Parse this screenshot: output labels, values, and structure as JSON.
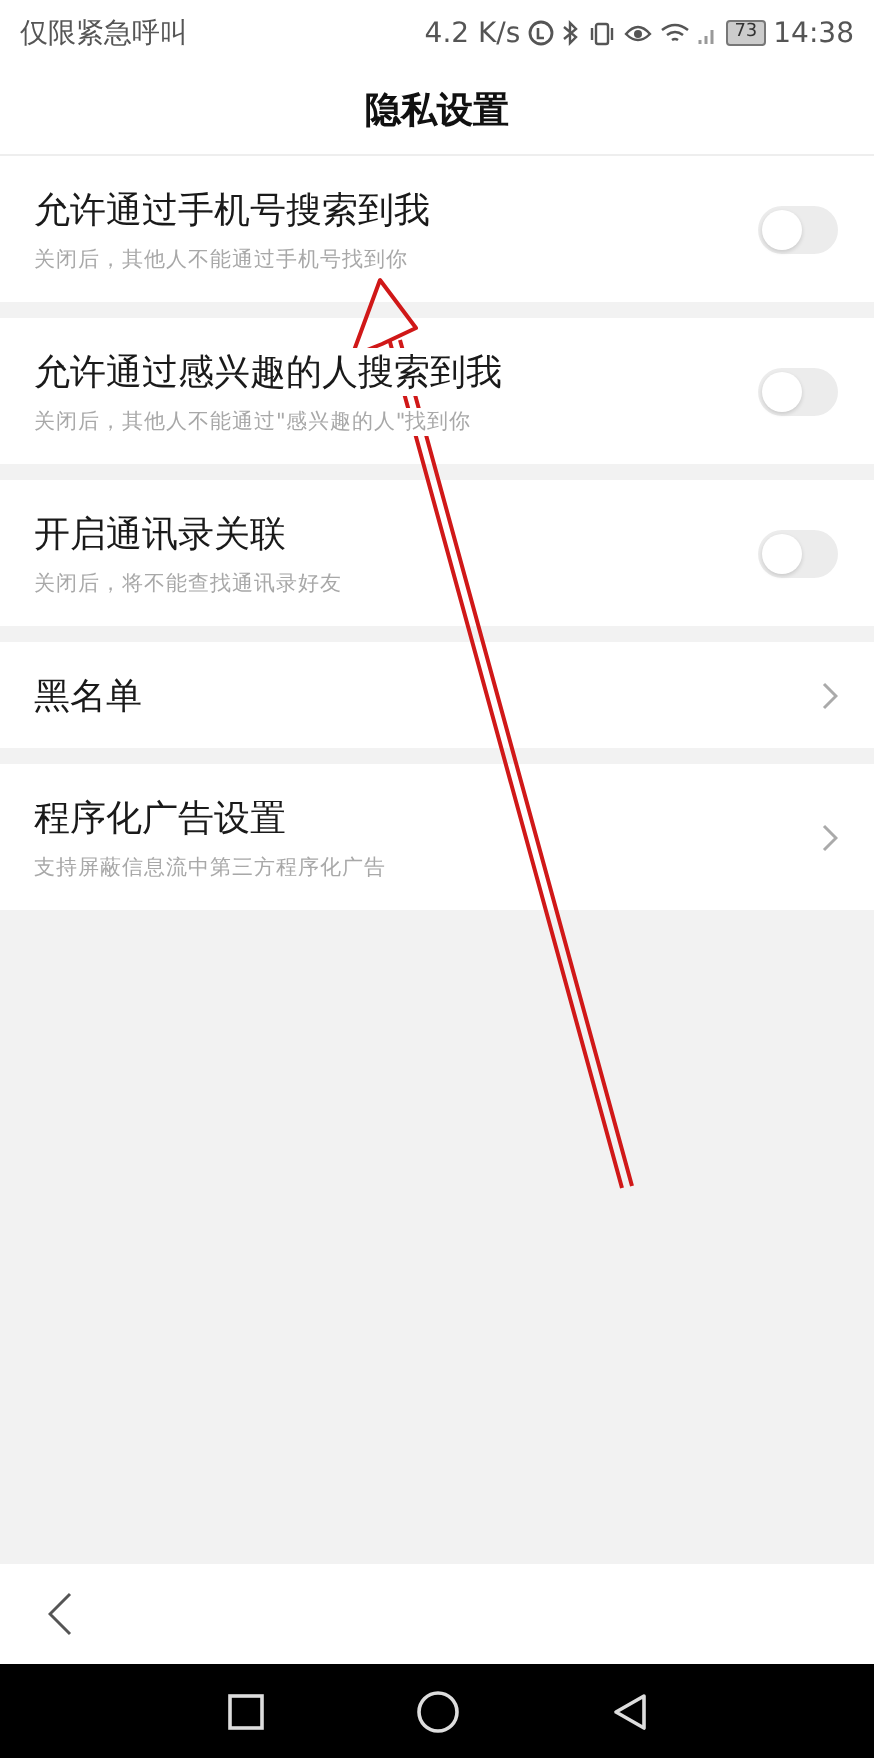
{
  "status_bar": {
    "carrier": "仅限紧急呼叫",
    "speed": "4.2 K/s",
    "battery": "73",
    "time": "14:38"
  },
  "title": "隐私设置",
  "sections": [
    {
      "kind": "toggle",
      "title": "允许通过手机号搜索到我",
      "subtitle": "关闭后，其他人不能通过手机号找到你",
      "on": false
    },
    {
      "kind": "toggle",
      "title": "允许通过感兴趣的人搜索到我",
      "subtitle": "关闭后，其他人不能通过\"感兴趣的人\"找到你",
      "on": false
    },
    {
      "kind": "toggle",
      "title": "开启通讯录关联",
      "subtitle": "关闭后，将不能查找通讯录好友",
      "on": false
    },
    {
      "kind": "link",
      "title": "黑名单"
    },
    {
      "kind": "link",
      "title": "程序化广告设置",
      "subtitle": "支持屏蔽信息流中第三方程序化广告"
    }
  ]
}
